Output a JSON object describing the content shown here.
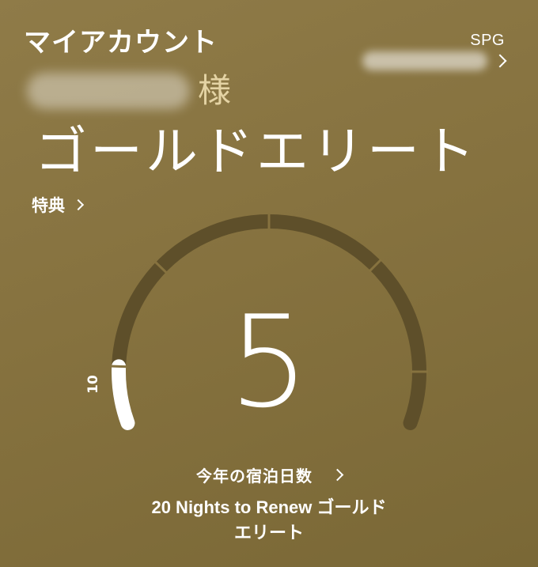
{
  "header": {
    "title": "マイアカウント",
    "program_label": "SPG"
  },
  "member": {
    "honorific": "様",
    "status_level": "ゴールドエリート",
    "benefits_label": "特典"
  },
  "gauge": {
    "nights_count": "5",
    "milestone_label": "10",
    "nights_value": 5,
    "gauge_max": 50,
    "nights_label": "今年の宿泊日数",
    "renew_line1": "20 Nights to Renew ゴールド",
    "renew_line2": "エリート"
  },
  "colors": {
    "background": "#86723f",
    "track": "#5e4f2a",
    "progress": "#ffffff",
    "honorific": "#e4d3a4"
  }
}
